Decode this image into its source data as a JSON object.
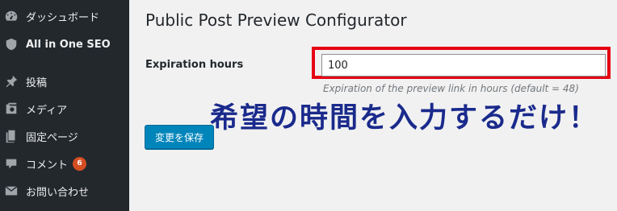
{
  "sidebar": {
    "items": [
      {
        "label": "ダッシュボード",
        "icon": "dashboard-icon"
      },
      {
        "label": "All in One SEO",
        "icon": "shield-icon"
      },
      {
        "label": "投稿",
        "icon": "pushpin-icon"
      },
      {
        "label": "メディア",
        "icon": "media-icon"
      },
      {
        "label": "固定ページ",
        "icon": "page-icon"
      },
      {
        "label": "コメント",
        "icon": "comment-icon",
        "badge": "6"
      },
      {
        "label": "お問い合わせ",
        "icon": "mail-icon"
      }
    ]
  },
  "main": {
    "title": "Public Post Preview Configurator",
    "field_label": "Expiration hours",
    "input_value": "100",
    "hint": "Expiration of the preview link in hours (default = 48)",
    "annotation": "希望の時間を入力するだけ！",
    "save_label": "変更を保存"
  },
  "colors": {
    "sidebar_bg": "#23282d",
    "highlight": "#e60012",
    "annotation": "#1a2a8c",
    "button": "#0085ba",
    "badge": "#d54e21"
  }
}
